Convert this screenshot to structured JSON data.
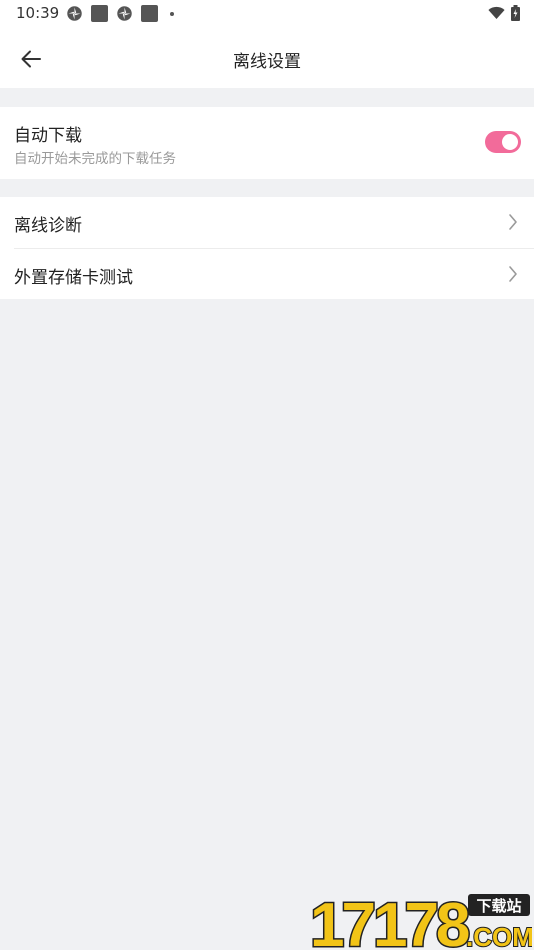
{
  "status_bar": {
    "time": "10:39"
  },
  "header": {
    "title": "离线设置"
  },
  "auto_download": {
    "title": "自动下载",
    "subtitle": "自动开始未完成的下载任务",
    "enabled": true
  },
  "menu": {
    "items": [
      {
        "label": "离线诊断"
      },
      {
        "label": "外置存储卡测试"
      }
    ]
  },
  "watermark": {
    "number": "17178",
    "tag": "下载站",
    "domain": ".COM"
  },
  "colors": {
    "accent": "#f26b9a",
    "background": "#f0f1f3"
  }
}
